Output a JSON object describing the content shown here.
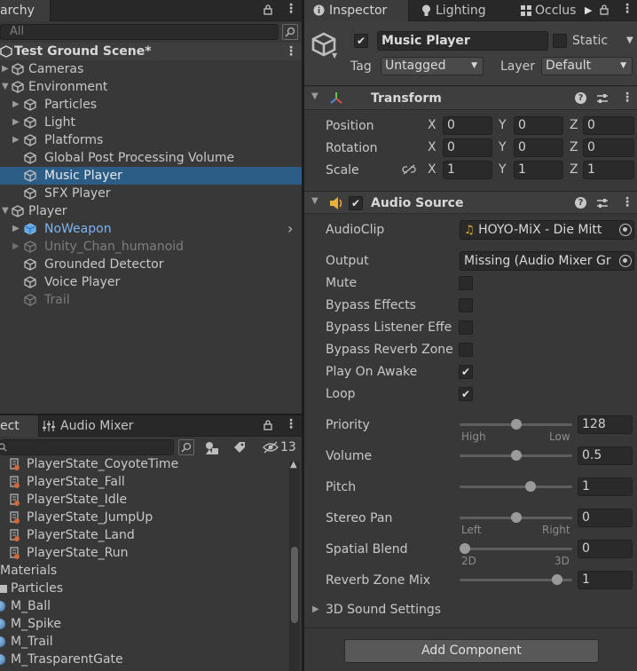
{
  "hierarchy": {
    "tab_label": "archy",
    "search_placeholder": "All",
    "scene_name": "Test Ground Scene*",
    "items": [
      {
        "label": "Cameras"
      },
      {
        "label": "Environment"
      },
      {
        "label": "Particles"
      },
      {
        "label": "Light"
      },
      {
        "label": "Platforms"
      },
      {
        "label": "Global Post Processing Volume"
      },
      {
        "label": "Music Player"
      },
      {
        "label": "SFX Player"
      },
      {
        "label": "Player"
      },
      {
        "label": "NoWeapon"
      },
      {
        "label": "Unity_Chan_humanoid"
      },
      {
        "label": "Grounded Detector"
      },
      {
        "label": "Voice Player"
      },
      {
        "label": "Trail"
      }
    ]
  },
  "project": {
    "tab_label": "ect",
    "tab_audio_mixer": "Audio Mixer",
    "hidden_count": "13",
    "items": [
      {
        "label": "PlayerState_CoyoteTime"
      },
      {
        "label": "PlayerState_Fall"
      },
      {
        "label": "PlayerState_Idle"
      },
      {
        "label": "PlayerState_JumpUp"
      },
      {
        "label": "PlayerState_Land"
      },
      {
        "label": "PlayerState_Run"
      },
      {
        "label": "Materials"
      },
      {
        "label": "Particles"
      },
      {
        "label": "M_Ball"
      },
      {
        "label": "M_Spike"
      },
      {
        "label": "M_Trail"
      },
      {
        "label": "M_TrasparentGate"
      }
    ]
  },
  "inspector": {
    "tabs": {
      "inspector": "Inspector",
      "lighting": "Lighting",
      "occlusion": "Occlus"
    },
    "object_name": "Music Player",
    "static_label": "Static",
    "tag_label": "Tag",
    "tag_value": "Untagged",
    "layer_label": "Layer",
    "layer_value": "Default",
    "transform": {
      "title": "Transform",
      "position_label": "Position",
      "rotation_label": "Rotation",
      "scale_label": "Scale",
      "axis_x": "X",
      "axis_y": "Y",
      "axis_z": "Z",
      "position": [
        "0",
        "0",
        "0"
      ],
      "rotation": [
        "0",
        "0",
        "0"
      ],
      "scale": [
        "1",
        "1",
        "1"
      ]
    },
    "audio_source": {
      "title": "Audio Source",
      "audioclip_label": "AudioClip",
      "audioclip_value": "HOYO-MiX - Die Mitt",
      "output_label": "Output",
      "output_value": "Missing (Audio Mixer Gr",
      "mute_label": "Mute",
      "bypass_effects_label": "Bypass Effects",
      "bypass_listener_label": "Bypass Listener Effe",
      "bypass_reverb_label": "Bypass Reverb Zone",
      "play_on_awake_label": "Play On Awake",
      "loop_label": "Loop",
      "mute": false,
      "bypass_effects": false,
      "bypass_listener": false,
      "bypass_reverb": false,
      "play_on_awake": true,
      "loop": true,
      "priority_label": "Priority",
      "priority_value": "128",
      "priority_fraction": 0.5,
      "priority_high": "High",
      "priority_low": "Low",
      "volume_label": "Volume",
      "volume_value": "0.5",
      "volume_fraction": 0.5,
      "pitch_label": "Pitch",
      "pitch_value": "1",
      "pitch_fraction": 0.64,
      "stereo_pan_label": "Stereo Pan",
      "stereo_pan_value": "0",
      "stereo_pan_fraction": 0.5,
      "pan_left": "Left",
      "pan_right": "Right",
      "spatial_blend_label": "Spatial Blend",
      "spatial_blend_value": "0",
      "spatial_blend_fraction": 0.0,
      "blend_2d": "2D",
      "blend_3d": "3D",
      "reverb_mix_label": "Reverb Zone Mix",
      "reverb_mix_value": "1",
      "reverb_mix_fraction": 0.9,
      "sound_settings_label": "3D Sound Settings"
    },
    "add_component_label": "Add Component"
  },
  "colors": {
    "selection": "#2c5d87",
    "prefab_blue": "#7cb4f0",
    "accent_audio": "#e8b23a"
  }
}
